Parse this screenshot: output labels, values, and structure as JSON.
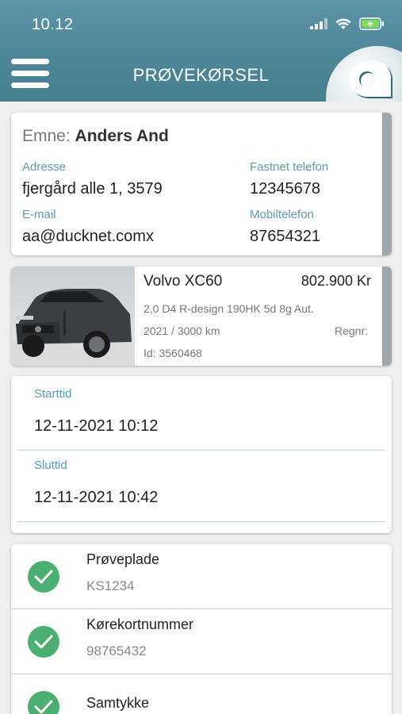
{
  "status_bar": {
    "time": "10.12"
  },
  "navbar": {
    "title": "PRØVEKØRSEL"
  },
  "customer": {
    "emne_label": "Emne:",
    "name": "Anders And",
    "address_label": "Adresse",
    "address": "fjergård alle 1, 3579",
    "landline_label": "Fastnet telefon",
    "landline": "12345678",
    "email_label": "E-mail",
    "email": "aa@ducknet.comx",
    "mobile_label": "Mobiltelefon",
    "mobile": "87654321"
  },
  "car": {
    "name": "Volvo XC60",
    "price": "802.900 Kr",
    "variant": "2,0 D4 R-design 190HK 5d 8g Aut.",
    "year_km": "2021 / 3000 km",
    "regnr_label": "Regnr:",
    "id": "Id: 3560468"
  },
  "times": {
    "start_label": "Starttid",
    "start_value": "12-11-2021 10:12",
    "end_label": "Sluttid",
    "end_value": "12-11-2021 10:42"
  },
  "checklist": [
    {
      "title": "Prøveplade",
      "value": "KS1234"
    },
    {
      "title": "Kørekortnummer",
      "value": "98765432"
    },
    {
      "title": "Samtykke",
      "value": ""
    }
  ],
  "colors": {
    "header": "#4e8799",
    "accent_label": "#5c9bb5",
    "check_green": "#4caf72"
  }
}
